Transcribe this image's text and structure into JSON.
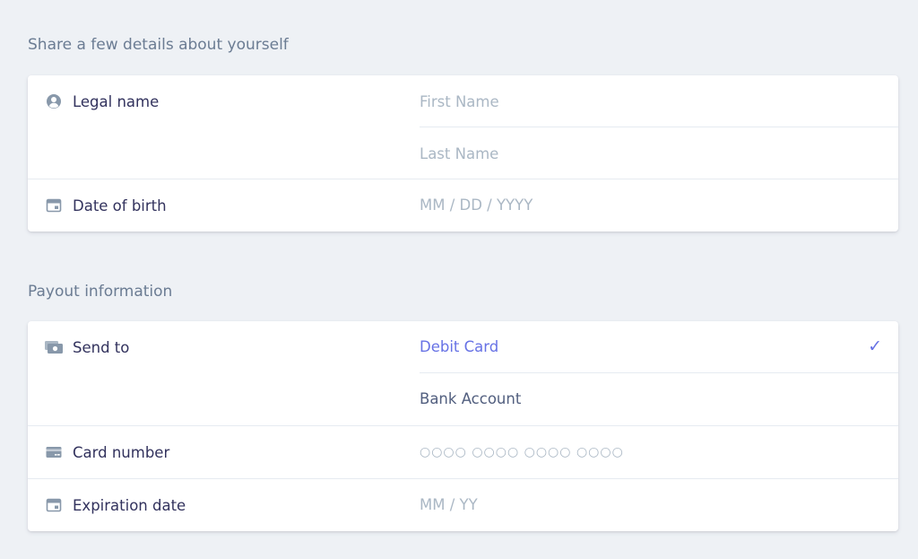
{
  "sections": {
    "personal": {
      "title": "Share a few details about yourself",
      "legal_name": {
        "label": "Legal name",
        "icon": "user-circle-icon",
        "first_placeholder": "First Name",
        "last_placeholder": "Last Name"
      },
      "dob": {
        "label": "Date of birth",
        "icon": "calendar-icon",
        "placeholder": "MM / DD / YYYY"
      }
    },
    "payout": {
      "title": "Payout information",
      "send_to": {
        "label": "Send to",
        "icon": "money-icon",
        "options": [
          {
            "label": "Debit Card",
            "selected": true
          },
          {
            "label": "Bank Account",
            "selected": false
          }
        ],
        "check_glyph": "✓"
      },
      "card_number": {
        "label": "Card number",
        "icon": "credit-card-icon",
        "placeholder": "○○○○ ○○○○ ○○○○ ○○○○"
      },
      "expiration": {
        "label": "Expiration date",
        "icon": "calendar-icon",
        "placeholder": "MM / YY"
      }
    }
  },
  "colors": {
    "background": "#eef1f5",
    "accent": "#6772e5",
    "label": "#32325d",
    "placeholder": "#aab7c4",
    "section_title": "#6b7c93"
  }
}
